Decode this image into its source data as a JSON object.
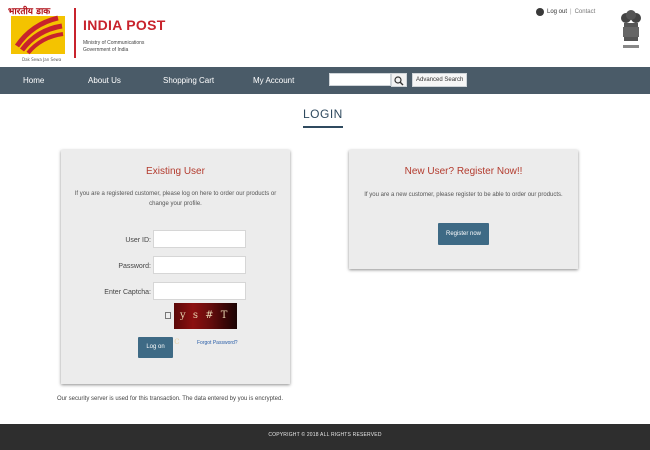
{
  "header": {
    "logo_hindi": "भारतीय डाक",
    "logo_tagline": "Dak Sewa Jan Sewa",
    "title": "INDIA POST",
    "subtitle_line1": "Ministry of Communications",
    "subtitle_line2": "Government of India",
    "top_links": {
      "logout": "Log out",
      "separator": "|",
      "contact": "Contact"
    },
    "emblem_text": "सत्यमेव जयते"
  },
  "nav": {
    "items": [
      {
        "label": "Home"
      },
      {
        "label": "About Us"
      },
      {
        "label": "Shopping Cart"
      },
      {
        "label": "My Account"
      }
    ],
    "search": {
      "value": "",
      "placeholder": ""
    },
    "advanced_search_label": "Advanced Search"
  },
  "page": {
    "title": "LOGIN"
  },
  "existing_user": {
    "heading": "Existing User",
    "intro": "If you are a registered customer, please log on here to order our products or change your profile.",
    "user_id_label": "User ID:",
    "password_label": "Password:",
    "captcha_label": "Enter Captcha:",
    "captcha_text": "y s # T c",
    "login_label": "Log on",
    "forgot_label": "Forgot Password?"
  },
  "new_user": {
    "heading": "New User? Register Now!!",
    "intro": "If you are a new customer, please register to be able to order our products.",
    "register_label": "Register now"
  },
  "security_note": "Our security server is used for this transaction. The data entered by you is encrypted.",
  "footer": {
    "copyright": "COPYRIGHT © 2018 ALL RIGHTS RESERVED"
  }
}
